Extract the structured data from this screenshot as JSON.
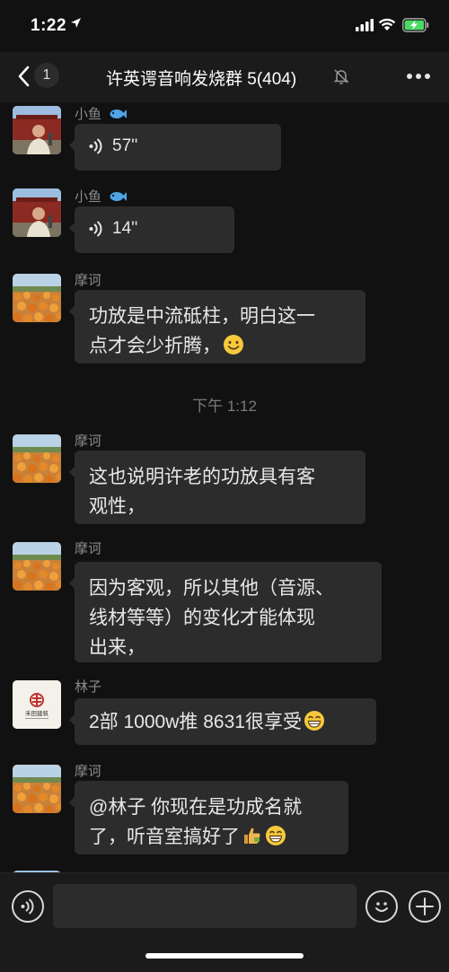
{
  "status_bar": {
    "time": "1:22",
    "battery_charging": true
  },
  "nav": {
    "back_count": "1",
    "title": "许英谔音响发烧群 5(404)",
    "muted": true
  },
  "messages": [
    {
      "sender": "小鱼",
      "type": "voice",
      "duration": "57''"
    },
    {
      "sender": "小鱼",
      "type": "voice",
      "duration": "14''"
    },
    {
      "sender": "摩诃",
      "type": "text",
      "lines": [
        "功放是中流砥柱，明白这一",
        "点才会少折腾，"
      ],
      "emoji": "smile"
    },
    {
      "sender": "摩诃",
      "type": "text",
      "lines": [
        "这也说明许老的功放具有客",
        "观性，"
      ]
    },
    {
      "sender": "摩诃",
      "type": "text",
      "lines": [
        "因为客观，所以其他（音源、",
        "线材等等）的变化才能体现",
        "出来，"
      ]
    },
    {
      "sender": "林子",
      "type": "text",
      "lines": [
        "2部 1000w推 8631很享受"
      ],
      "emoji": "grin"
    },
    {
      "sender": "摩诃",
      "type": "text",
      "lines": [
        "@林子 你现在是功成名就",
        "了，听音室搞好了"
      ],
      "emoji": "thumbs-grin"
    }
  ],
  "timestamp": "下午 1:12",
  "avatar_logo_text": "禾田建筑",
  "input": {
    "placeholder": ""
  },
  "icons": {
    "back": "chevron-left-icon",
    "mute": "bell-off-icon",
    "more": "more-dots-icon",
    "voice": "voice-wave-icon",
    "emoji": "emoji-icon",
    "plus": "plus-icon"
  },
  "colors": {
    "background": "#111111",
    "bubble": "#2c2c2c",
    "nav": "#1b1b1b",
    "text": "#e8e8e8",
    "muted_text": "#8c8c8c"
  }
}
